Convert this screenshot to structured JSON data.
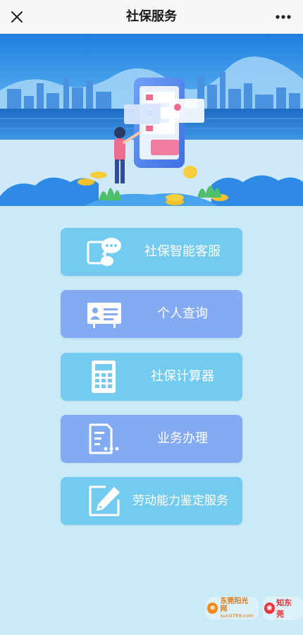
{
  "header": {
    "title": "社保服务",
    "close_icon": "close-icon",
    "more_icon": "more-dots-icon"
  },
  "banner": {
    "description_icon": "service-illustration"
  },
  "menu": [
    {
      "label": "社保智能客服",
      "icon": "chat-bubbles-icon",
      "color": "#73cbef"
    },
    {
      "label": "个人查询",
      "icon": "id-card-icon",
      "color": "#84aaf3"
    },
    {
      "label": "社保计算器",
      "icon": "calculator-icon",
      "color": "#73cbef"
    },
    {
      "label": "业务办理",
      "icon": "document-icon",
      "color": "#84aaf3"
    },
    {
      "label": "劳动能力鉴定服务",
      "icon": "edit-pen-icon",
      "color": "#73cbef"
    }
  ],
  "watermark": {
    "site1": "东莞阳光网",
    "site1_sub": "sun0769.com",
    "site2": "知东莞"
  }
}
